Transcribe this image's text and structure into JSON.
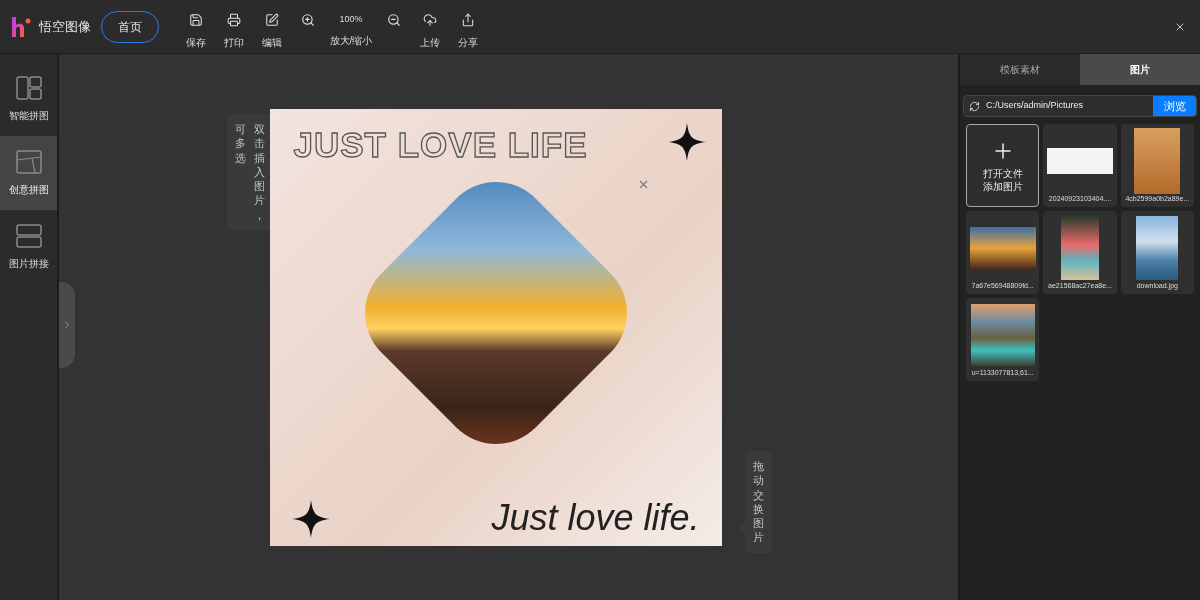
{
  "app": {
    "name": "悟空图像",
    "home": "首页"
  },
  "toolbar_left": [
    {
      "label": "保存"
    },
    {
      "label": "打印"
    },
    {
      "label": "编辑"
    }
  ],
  "zoom": {
    "value": "100%",
    "label": "放大/缩小"
  },
  "toolbar_right": [
    {
      "label": "上传"
    },
    {
      "label": "分享"
    }
  ],
  "sidebar": {
    "items": [
      {
        "label": "智能拼图",
        "selected": false
      },
      {
        "label": "创意拼图",
        "selected": true
      },
      {
        "label": "图片拼接",
        "selected": false
      }
    ]
  },
  "hints": [
    {
      "columns": [
        "可多选",
        "双击插入图片，"
      ]
    },
    {
      "columns": [
        "拖动交换图片"
      ]
    }
  ],
  "poster": {
    "headline": "JUST LOVE LIFE",
    "tagline": "Just love life."
  },
  "panel": {
    "tabs": [
      {
        "label": "模板素材",
        "selected": false
      },
      {
        "label": "图片",
        "selected": true
      }
    ],
    "path": "C:/Users/admin/Pictures",
    "browse": "浏览",
    "add_tile": [
      "打开文件",
      "添加图片"
    ],
    "images": [
      {
        "name": "20240923103404...."
      },
      {
        "name": "4cb2599a0b2a89e..."
      },
      {
        "name": "7a67e56948809fd..."
      },
      {
        "name": "ae21568ac27ea8e..."
      },
      {
        "name": "download.jpg"
      },
      {
        "name": "u=1133077813,61..."
      }
    ]
  }
}
